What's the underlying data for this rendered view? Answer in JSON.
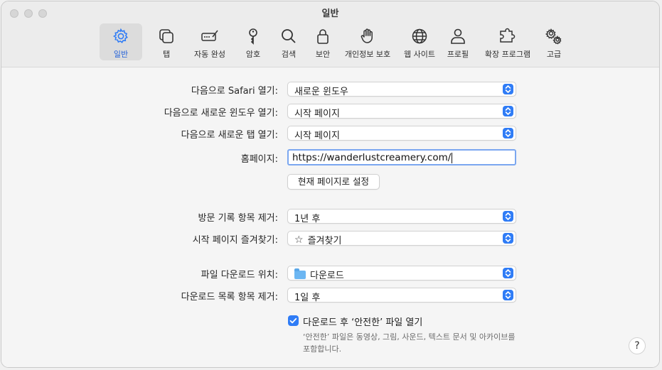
{
  "window": {
    "title": "일반"
  },
  "toolbar": [
    {
      "name": "general",
      "label": "일반",
      "icon": "gear-icon",
      "active": true
    },
    {
      "name": "tabs",
      "label": "탭",
      "icon": "tabs-icon",
      "active": false
    },
    {
      "name": "autofill",
      "label": "자동 완성",
      "icon": "pencil-field-icon",
      "active": false
    },
    {
      "name": "passwords",
      "label": "암호",
      "icon": "key-icon",
      "active": false
    },
    {
      "name": "search",
      "label": "검색",
      "icon": "search-icon",
      "active": false
    },
    {
      "name": "security",
      "label": "보안",
      "icon": "lock-icon",
      "active": false
    },
    {
      "name": "privacy",
      "label": "개인정보 보호",
      "icon": "hand-icon",
      "active": false
    },
    {
      "name": "websites",
      "label": "웹 사이트",
      "icon": "globe-icon",
      "active": false
    },
    {
      "name": "profiles",
      "label": "프로필",
      "icon": "person-icon",
      "active": false
    },
    {
      "name": "extensions",
      "label": "확장 프로그램",
      "icon": "puzzle-icon",
      "active": false
    },
    {
      "name": "advanced",
      "label": "고급",
      "icon": "gears-icon",
      "active": false
    }
  ],
  "general": {
    "open_with_label": "다음으로 Safari 열기:",
    "open_with_value": "새로운 윈도우",
    "new_window_label": "다음으로 새로운 윈도우 열기:",
    "new_window_value": "시작 페이지",
    "new_tab_label": "다음으로 새로운 탭 열기:",
    "new_tab_value": "시작 페이지",
    "homepage_label": "홈페이지:",
    "homepage_value": "https://wanderlustcreamery.com/",
    "set_current_button": "현재 페이지로 설정",
    "remove_history_label": "방문 기록 항목 제거:",
    "remove_history_value": "1년 후",
    "favorites_label": "시작 페이지 즐겨찾기:",
    "favorites_value": "즐겨찾기",
    "download_location_label": "파일 다운로드 위치:",
    "download_location_value": "다운로드",
    "remove_downloads_label": "다운로드 목록 항목 제거:",
    "remove_downloads_value": "1일 후",
    "open_safe_files_label": "다운로드 후 ‘안전한’ 파일 열기",
    "open_safe_files_checked": true,
    "safe_files_note": "‘안전한’ 파일은 동영상, 그림, 사운드, 텍스트 문서 및 아카이브를 포함합니다.",
    "help_label": "?"
  },
  "colors": {
    "accent": "#2f7cf6",
    "active_label": "#2563d9"
  }
}
